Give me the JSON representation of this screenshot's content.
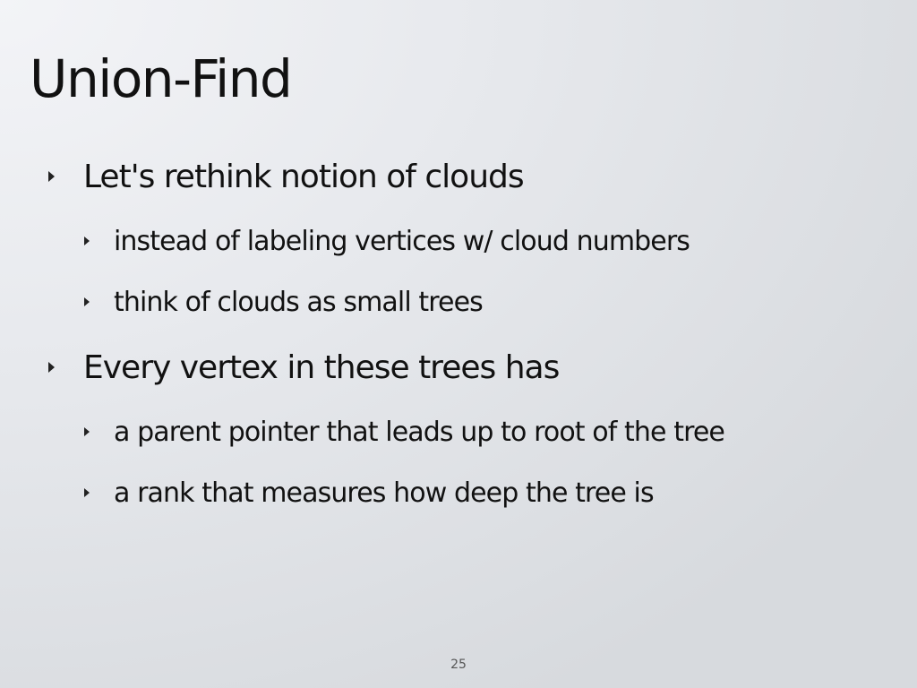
{
  "slide": {
    "title": "Union-Find",
    "bullets": [
      {
        "text": "Let's rethink notion of clouds",
        "sub": [
          "instead of labeling vertices w/ cloud numbers",
          "think of clouds as small trees"
        ]
      },
      {
        "text": "Every vertex in these trees has",
        "sub": [
          "a parent pointer that leads up to root of the tree",
          "a rank that measures how deep the tree is"
        ]
      }
    ],
    "page_number": "25"
  }
}
